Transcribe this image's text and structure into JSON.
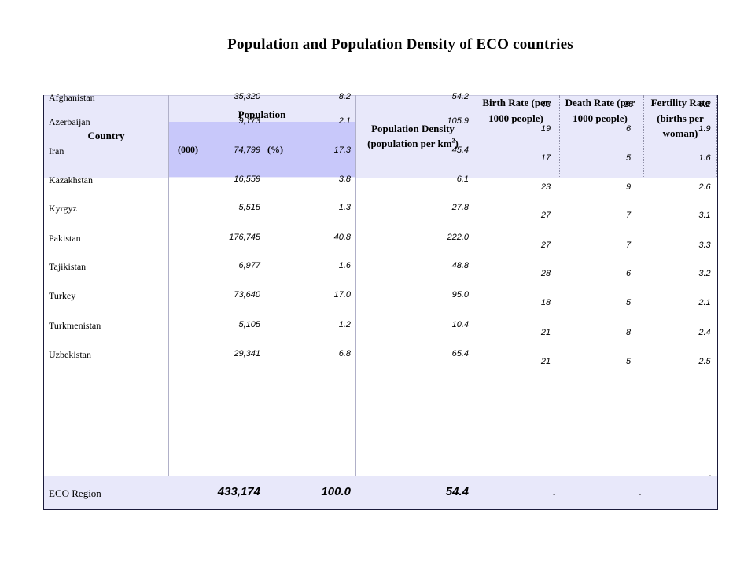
{
  "title": "Population and Population Density of ECO countries",
  "headers": {
    "country": "Country",
    "population": "Population",
    "pop_thousands": "(000)",
    "pop_percent": "(%)",
    "density": "Population Density (population per km",
    "density_sup": "2",
    "density_close": ")",
    "birth_rate": "Birth Rate (per 1000 people)",
    "death_rate": "Death Rate (per 1000 people)",
    "fertility": "Fertility Rate (births per woman)"
  },
  "rows": [
    {
      "country": "Afghanistan",
      "pop": "35,320",
      "pct": "8.2",
      "density": "54.2",
      "birth": "43",
      "death": "16",
      "fertility": "6.2"
    },
    {
      "country": "Azerbaijan",
      "pop": "9,173",
      "pct": "2.1",
      "density": "105.9",
      "birth": "19",
      "death": "6",
      "fertility": "1.9"
    },
    {
      "country": "Iran",
      "pop": "74,799",
      "pct": "17.3",
      "density": "45.4",
      "birth": "17",
      "death": "5",
      "fertility": "1.6"
    },
    {
      "country": "Kazakhstan",
      "pop": "16,559",
      "pct": "3.8",
      "density": "6.1",
      "birth": "23",
      "death": "9",
      "fertility": "2.6"
    },
    {
      "country": "Kyrgyz",
      "pop": "5,515",
      "pct": "1.3",
      "density": "27.8",
      "birth": "27",
      "death": "7",
      "fertility": "3.1"
    },
    {
      "country": "Pakistan",
      "pop": "176,745",
      "pct": "40.8",
      "density": "222.0",
      "birth": "27",
      "death": "7",
      "fertility": "3.3"
    },
    {
      "country": "Tajikistan",
      "pop": "6,977",
      "pct": "1.6",
      "density": "48.8",
      "birth": "28",
      "death": "6",
      "fertility": "3.2"
    },
    {
      "country": "Turkey",
      "pop": "73,640",
      "pct": "17.0",
      "density": "95.0",
      "birth": "18",
      "death": "5",
      "fertility": "2.1"
    },
    {
      "country": "Turkmenistan",
      "pop": "5,105",
      "pct": "1.2",
      "density": "10.4",
      "birth": "21",
      "death": "8",
      "fertility": "2.4"
    },
    {
      "country": "Uzbekistan",
      "pop": "29,341",
      "pct": "6.8",
      "density": "65.4",
      "birth": "21",
      "death": "5",
      "fertility": "2.5"
    }
  ],
  "total": {
    "country": "ECO Region",
    "pop": "433,174",
    "pct": "100.0",
    "density": "54.4",
    "birth": "-",
    "death": "-",
    "fertility": "-"
  }
}
